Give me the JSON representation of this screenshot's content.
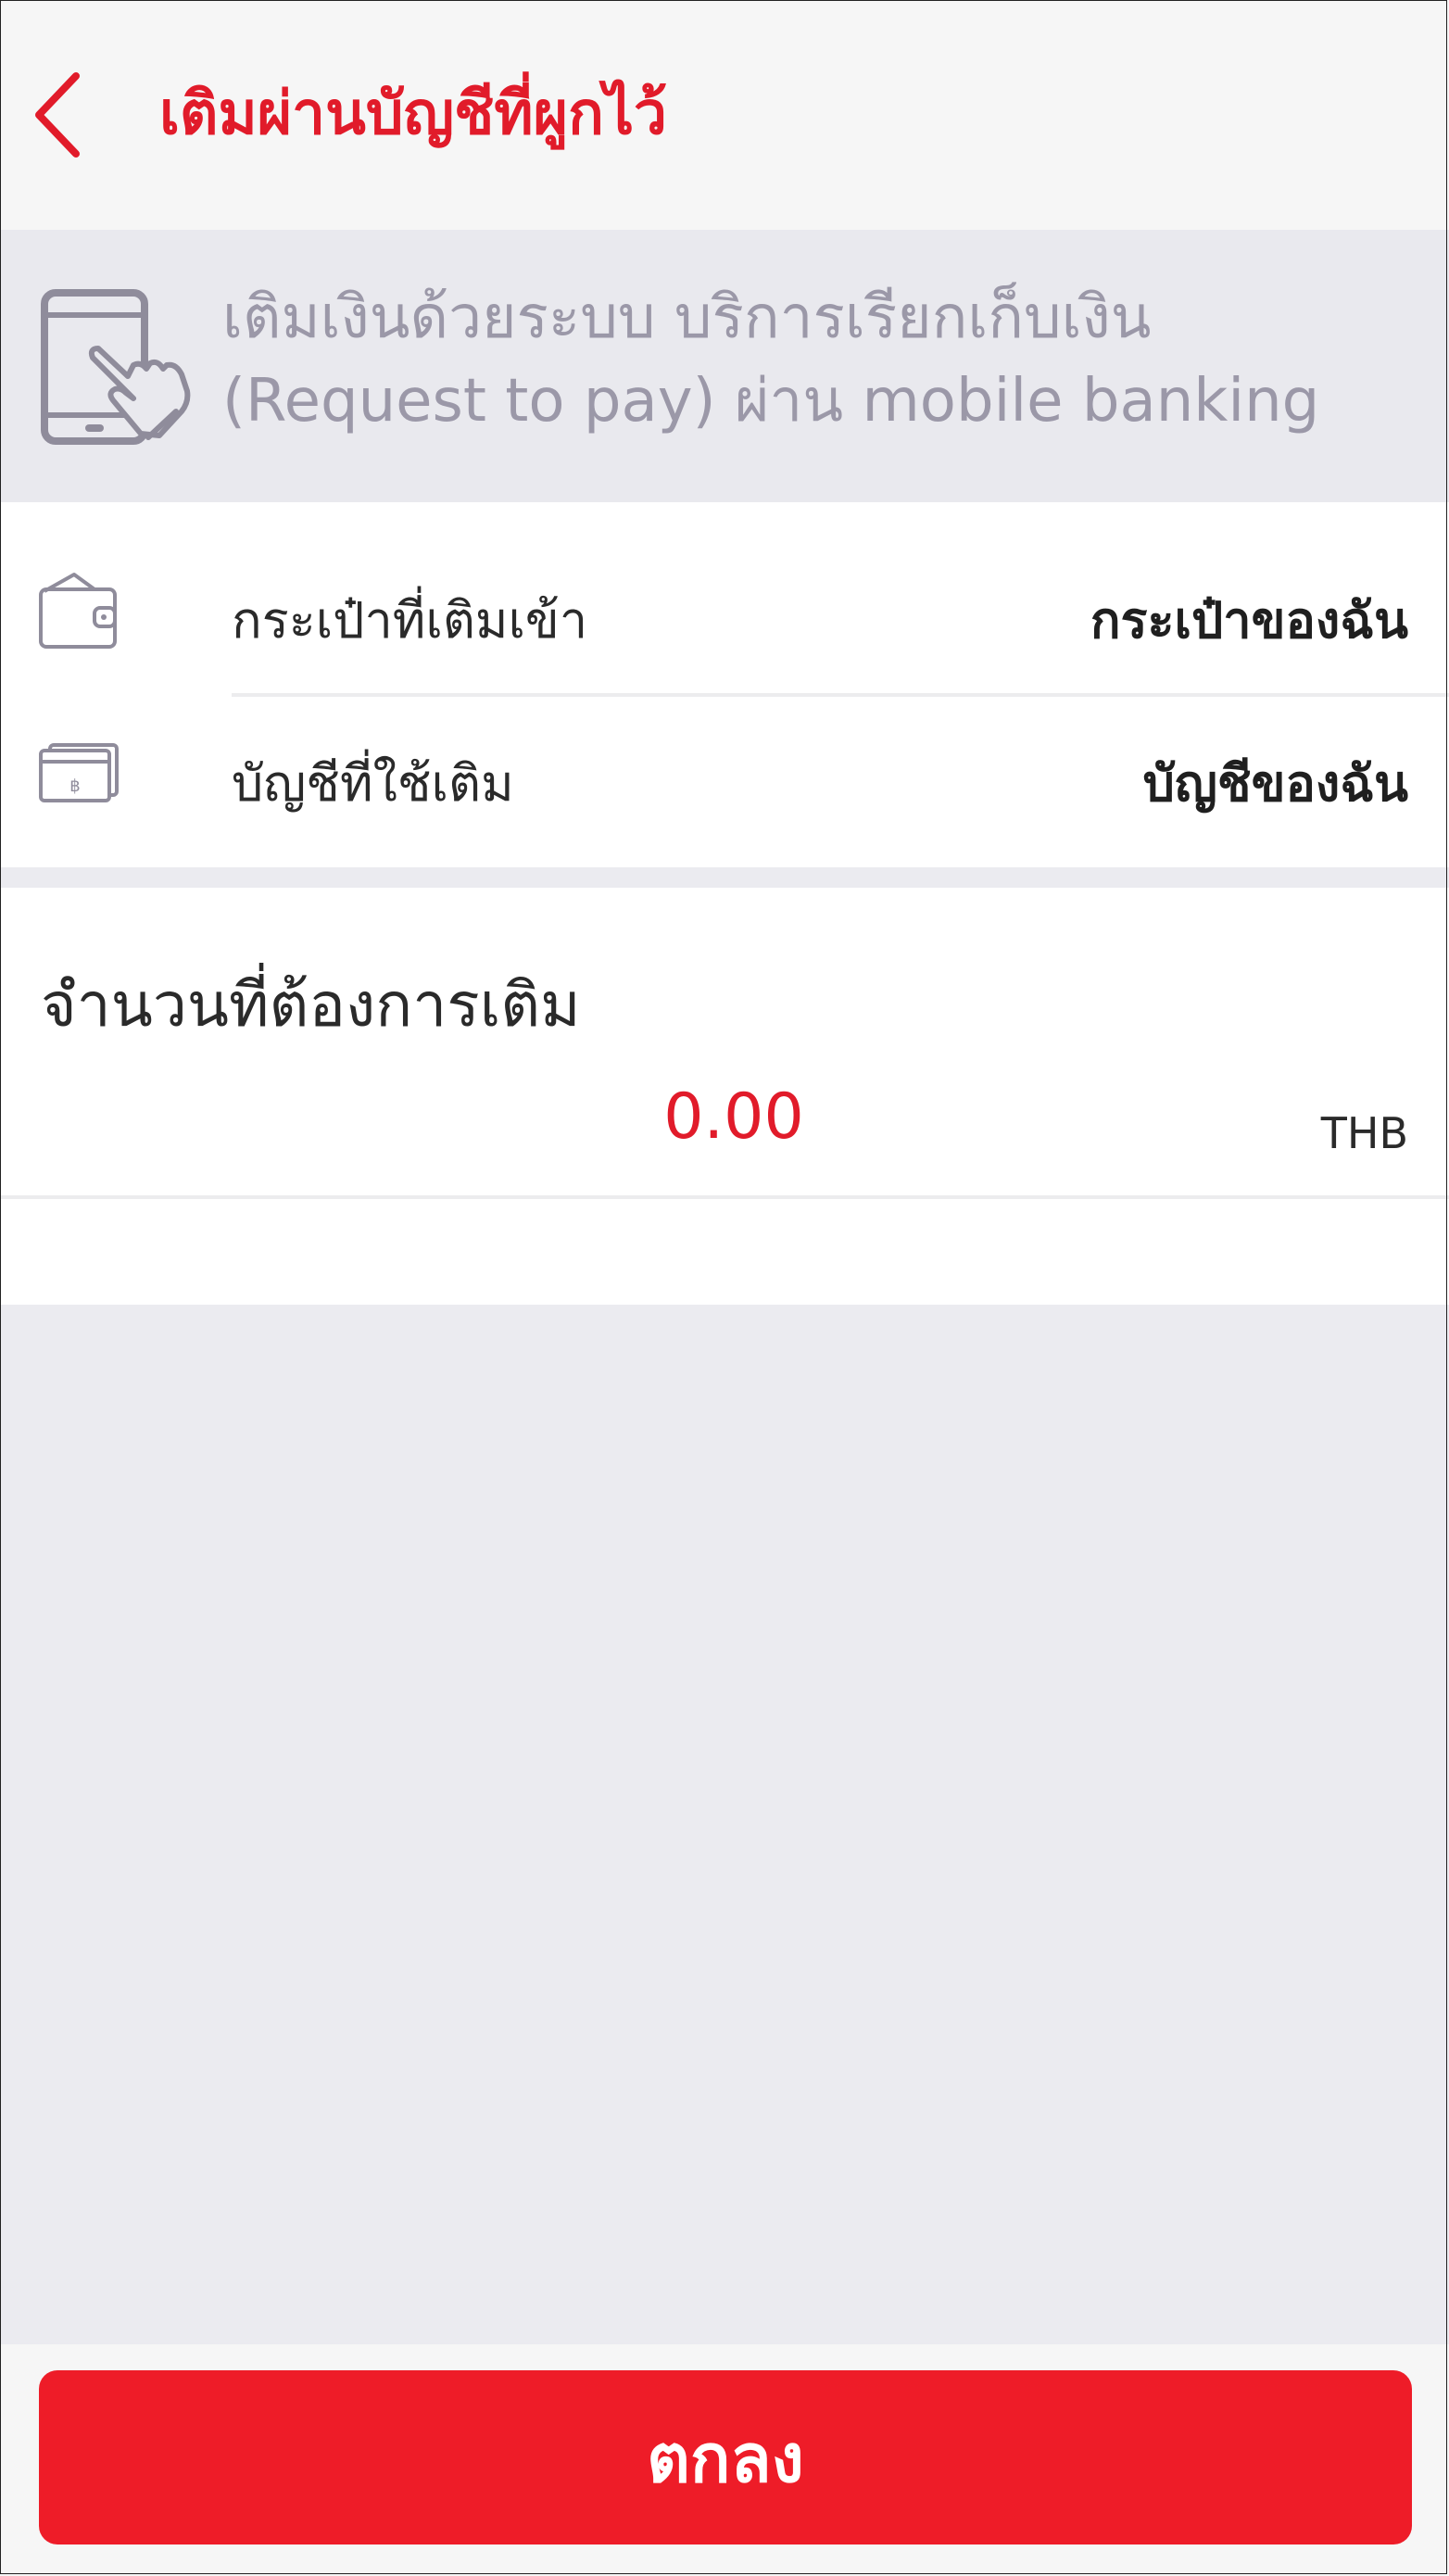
{
  "header": {
    "title": "เติมผ่านบัญชีที่ผูกไว้",
    "back_icon": "chevron-left-icon",
    "accent_color": "#e11b2a"
  },
  "banner": {
    "icon": "tablet-tap-icon",
    "line1": "เติมเงินด้วยระบบ บริการเรียกเก็บเงิน",
    "line2": "(Request to pay) ผ่าน mobile banking"
  },
  "rows": [
    {
      "icon": "wallet-icon",
      "label": "กระเป๋าที่เติมเข้า",
      "value": "กระเป๋าของฉัน"
    },
    {
      "icon": "bank-card-icon",
      "label": "บัญชีที่ใช้เติม",
      "value": "บัญชีของฉัน"
    }
  ],
  "amount": {
    "title": "จำนวนที่ต้องการเติม",
    "value": "0.00",
    "currency": "THB"
  },
  "footer": {
    "ok_label": "ตกลง",
    "button_color": "#ee1c28"
  }
}
